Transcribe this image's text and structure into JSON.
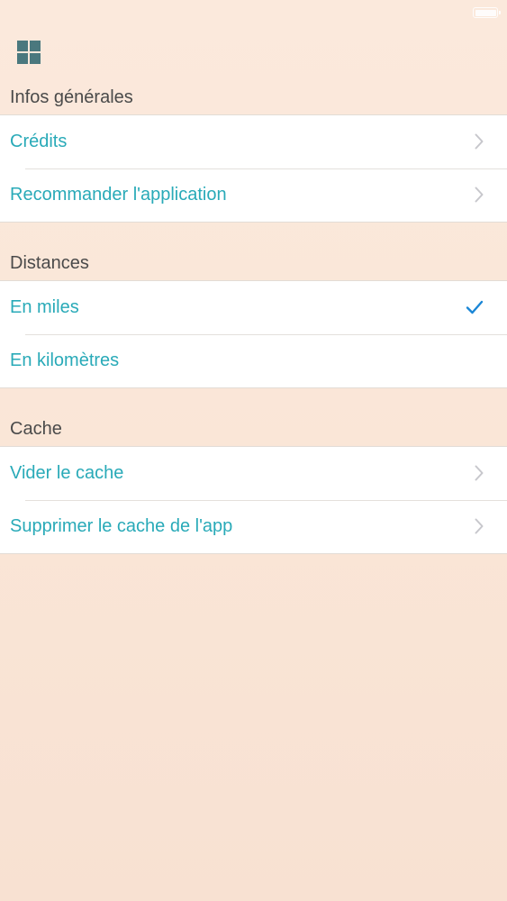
{
  "status_bar": {
    "battery_icon": "battery-icon"
  },
  "toolbar": {
    "menu_icon": "grid-icon"
  },
  "sections": {
    "general": {
      "header": "Infos générales",
      "items": [
        {
          "label": "Crédits",
          "accessory": "chevron"
        },
        {
          "label": "Recommander l'application",
          "accessory": "chevron"
        }
      ]
    },
    "distances": {
      "header": "Distances",
      "items": [
        {
          "label": "En miles",
          "accessory": "checkmark",
          "selected": true
        },
        {
          "label": "En kilomètres",
          "accessory": "none",
          "selected": false
        }
      ]
    },
    "cache": {
      "header": "Cache",
      "items": [
        {
          "label": "Vider le cache",
          "accessory": "chevron"
        },
        {
          "label": "Supprimer le cache de l'app",
          "accessory": "chevron"
        }
      ]
    }
  },
  "colors": {
    "accent": "#29aab8",
    "checkmark": "#1a86d6",
    "chevron": "#c7c7cc",
    "header_text": "#4a4a4a",
    "icon": "#4a787e",
    "background": "#fae6d7"
  }
}
